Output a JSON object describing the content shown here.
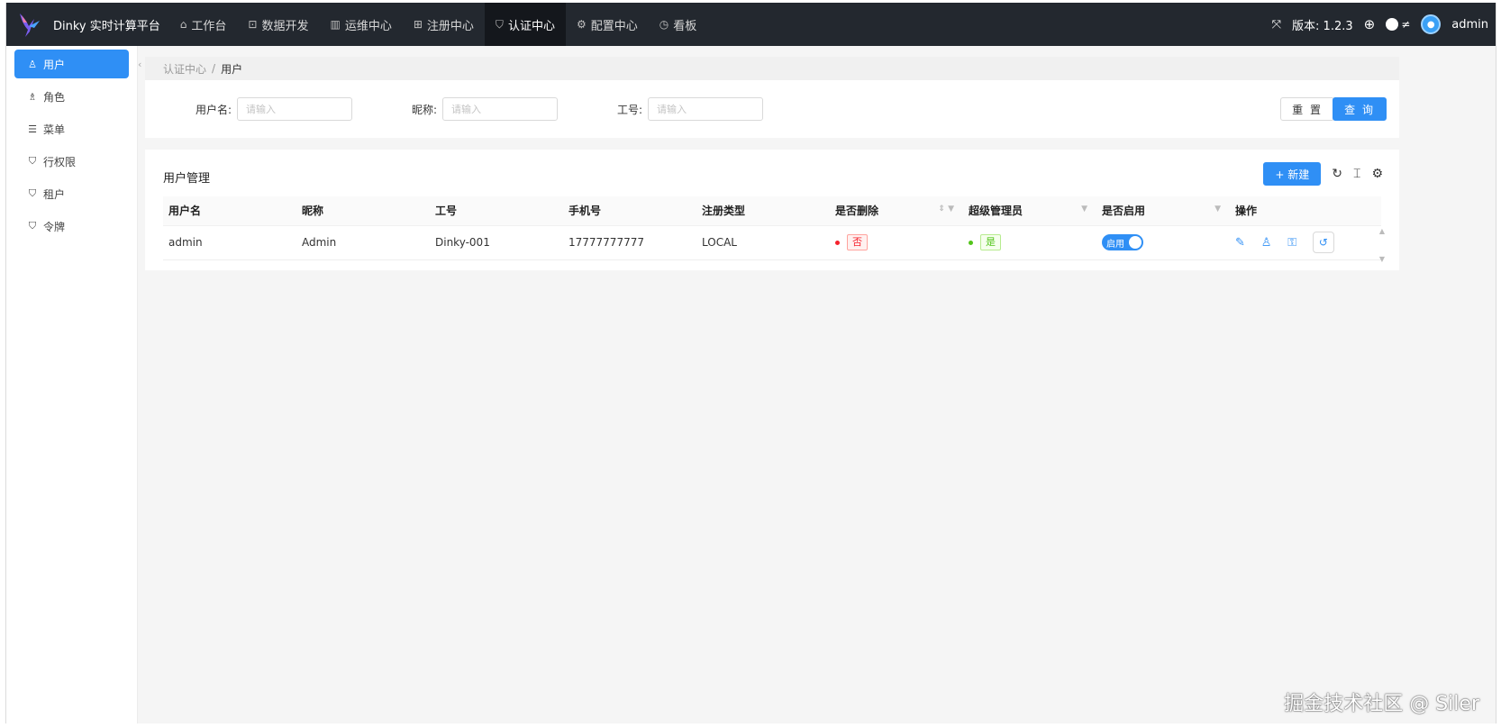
{
  "header": {
    "brand": "Dinky 实时计算平台",
    "nav": [
      {
        "label": "工作台",
        "icon": "home-icon"
      },
      {
        "label": "数据开发",
        "icon": "terminal-icon"
      },
      {
        "label": "运维中心",
        "icon": "monitor-icon"
      },
      {
        "label": "注册中心",
        "icon": "grid-icon"
      },
      {
        "label": "认证中心",
        "icon": "shield-icon",
        "active": true
      },
      {
        "label": "配置中心",
        "icon": "gear-icon"
      },
      {
        "label": "看板",
        "icon": "dashboard-icon"
      }
    ],
    "version_label": "版本: 1.2.3",
    "user": "admin"
  },
  "sidebar": {
    "items": [
      {
        "label": "用户",
        "icon": "user-icon",
        "active": true
      },
      {
        "label": "角色",
        "icon": "users-icon"
      },
      {
        "label": "菜单",
        "icon": "menu-icon"
      },
      {
        "label": "行权限",
        "icon": "shield-icon"
      },
      {
        "label": "租户",
        "icon": "shield-icon"
      },
      {
        "label": "令牌",
        "icon": "shield-icon"
      }
    ]
  },
  "breadcrumb": {
    "parent": "认证中心",
    "separator": "/",
    "current": "用户"
  },
  "search": {
    "username_label": "用户名:",
    "nickname_label": "昵称:",
    "worknum_label": "工号:",
    "placeholder": "请输入",
    "reset_label": "重 置",
    "query_label": "查 询"
  },
  "table": {
    "title": "用户管理",
    "new_label": "+ 新建",
    "columns": [
      "用户名",
      "昵称",
      "工号",
      "手机号",
      "注册类型",
      "是否删除",
      "超级管理员",
      "是否启用",
      "操作"
    ],
    "rows": [
      {
        "username": "admin",
        "nickname": "Admin",
        "worknum": "Dinky-001",
        "mobile": "17777777777",
        "reg_type": "LOCAL",
        "is_delete": "否",
        "super_admin": "是",
        "enabled": "启用"
      }
    ]
  },
  "watermark": "掘金技术社区 @ Siler",
  "colors": {
    "primary": "#2f8ff5",
    "header_bg": "#23282f",
    "delete_no": "#f5222d",
    "admin_yes": "#52c41a"
  }
}
